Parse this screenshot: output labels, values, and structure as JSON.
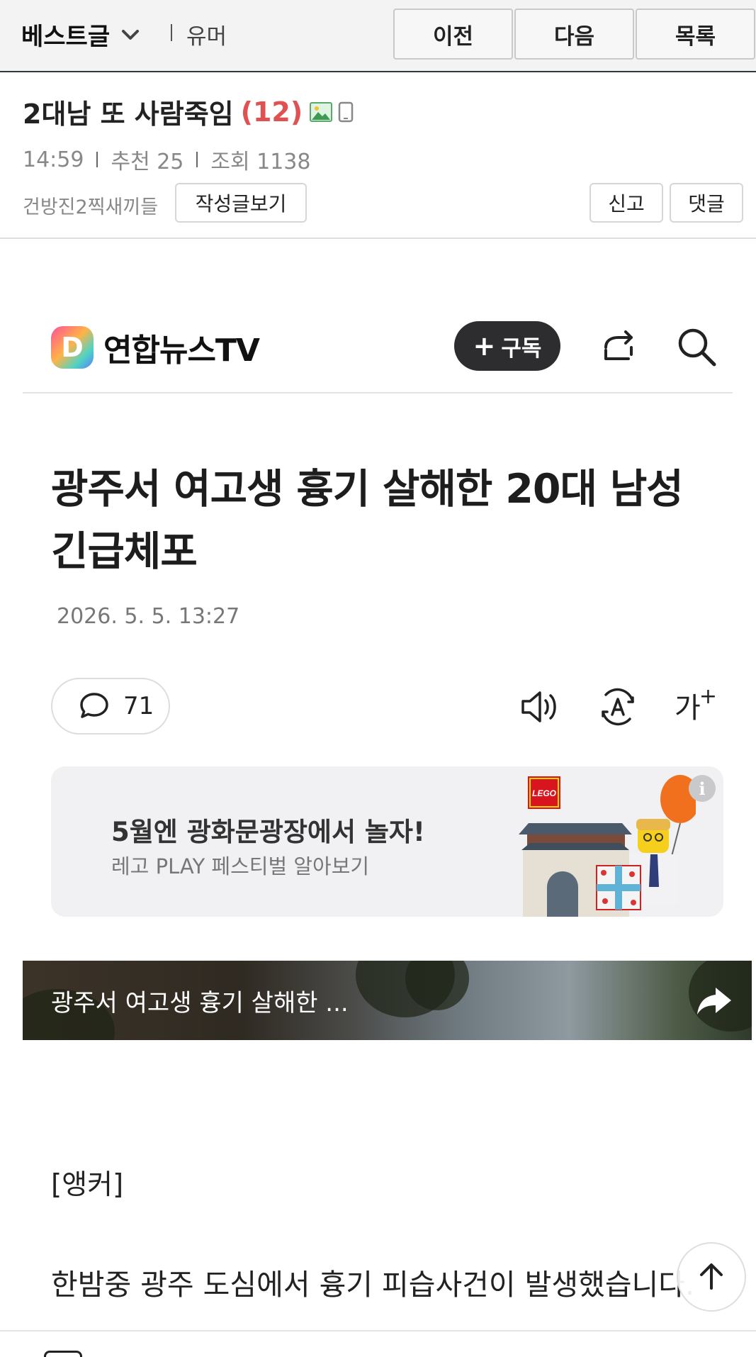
{
  "topbar": {
    "board_name": "베스트글",
    "category": "유머",
    "prev_label": "이전",
    "next_label": "다음",
    "list_label": "목록"
  },
  "post": {
    "title": "2대남 또 사람죽임",
    "comment_count": "(12)",
    "time": "14:59",
    "recommend": "추천 25",
    "views": "조회 1138",
    "author": "건방진2찍새끼들",
    "view_posts_label": "작성글보기",
    "report_label": "신고",
    "comments_label": "댓글"
  },
  "article": {
    "publisher_logo_letter": "D",
    "publisher": "연합뉴스TV",
    "subscribe_label": "구독",
    "subscribe_plus": "+",
    "headline": "광주서 여고생 흉기 살해한 20대 남성 긴급체포",
    "date": "2026. 5. 5. 13:27",
    "comment_count": "71",
    "fontsize_label": "가",
    "fontsize_plus": "+",
    "ad": {
      "title": "5월엔 광화문광장에서 놀자!",
      "subtitle": "레고 PLAY 페스티벌 알아보기",
      "brand": "LEGO",
      "info": "i"
    },
    "video_title": "광주서 여고생 흉기 살해한 ...",
    "anchor": "[앵커]",
    "body": "한밤중 광주 도심에서 흉기 피습사건이 발생했습니다."
  },
  "colors": {
    "accent_count": "#e05252",
    "topbar_bg": "#f3f3f3",
    "subscribe_bg": "#2d2d30",
    "ad_bg": "#f1f1f3"
  },
  "icons": {
    "board_dropdown": "chevron-down-icon",
    "image_attached": "image-icon",
    "mobile": "mobile-icon",
    "share": "share-icon",
    "search": "search-icon",
    "comment": "speech-bubble-icon",
    "speaker": "speaker-icon",
    "translate": "translate-icon",
    "scroll_top": "arrow-up-icon"
  }
}
